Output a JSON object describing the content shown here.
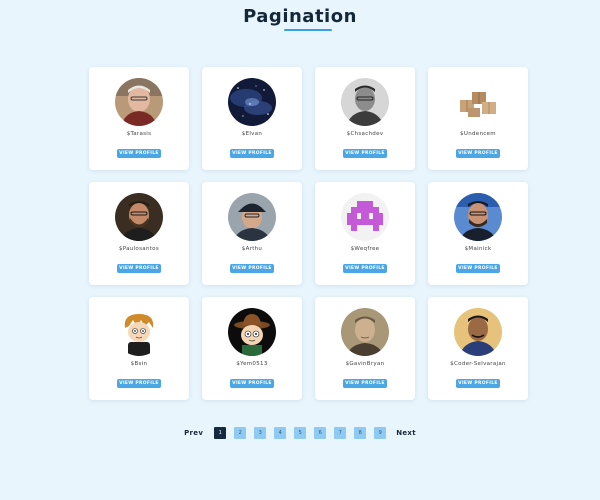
{
  "header": {
    "title": "Pagination"
  },
  "users": [
    {
      "name": "$Tarasis",
      "button": "VIEW PROFILE",
      "avatar": "avatar-older-man-photo"
    },
    {
      "name": "$Elvan",
      "button": "VIEW PROFILE",
      "avatar": "avatar-galaxy-image"
    },
    {
      "name": "$Chsachdev",
      "button": "VIEW PROFILE",
      "avatar": "avatar-bw-man-photo"
    },
    {
      "name": "$Undencem",
      "button": "VIEW PROFILE",
      "avatar": "avatar-boxes-image"
    },
    {
      "name": "$Paulosantos",
      "button": "VIEW PROFILE",
      "avatar": "avatar-bearded-man-photo"
    },
    {
      "name": "$Arthu",
      "button": "VIEW PROFILE",
      "avatar": "avatar-man-cap-photo"
    },
    {
      "name": "$Weqfree",
      "button": "VIEW PROFILE",
      "avatar": "avatar-pixel-invader"
    },
    {
      "name": "$Mainick",
      "button": "VIEW PROFILE",
      "avatar": "avatar-man-glasses-photo"
    },
    {
      "name": "$Bsin",
      "button": "VIEW PROFILE",
      "avatar": "avatar-cartoon-character"
    },
    {
      "name": "$Yem0513",
      "button": "VIEW PROFILE",
      "avatar": "avatar-cartoon-cowboy"
    },
    {
      "name": "$GavinBryan",
      "button": "VIEW PROFILE",
      "avatar": "avatar-sepia-man-photo"
    },
    {
      "name": "$Coder-Selvarajan",
      "button": "VIEW PROFILE",
      "avatar": "avatar-man-blue-shirt-photo"
    }
  ],
  "pagination": {
    "prev": "Prev",
    "next": "Next",
    "pages": [
      "1",
      "2",
      "3",
      "4",
      "5",
      "6",
      "7",
      "8",
      "9"
    ],
    "active_page": "1"
  },
  "colors": {
    "background": "#e8f5fd",
    "accent": "#4ba6e6",
    "active_page": "#142a40",
    "page_button": "#8fcaf2"
  }
}
